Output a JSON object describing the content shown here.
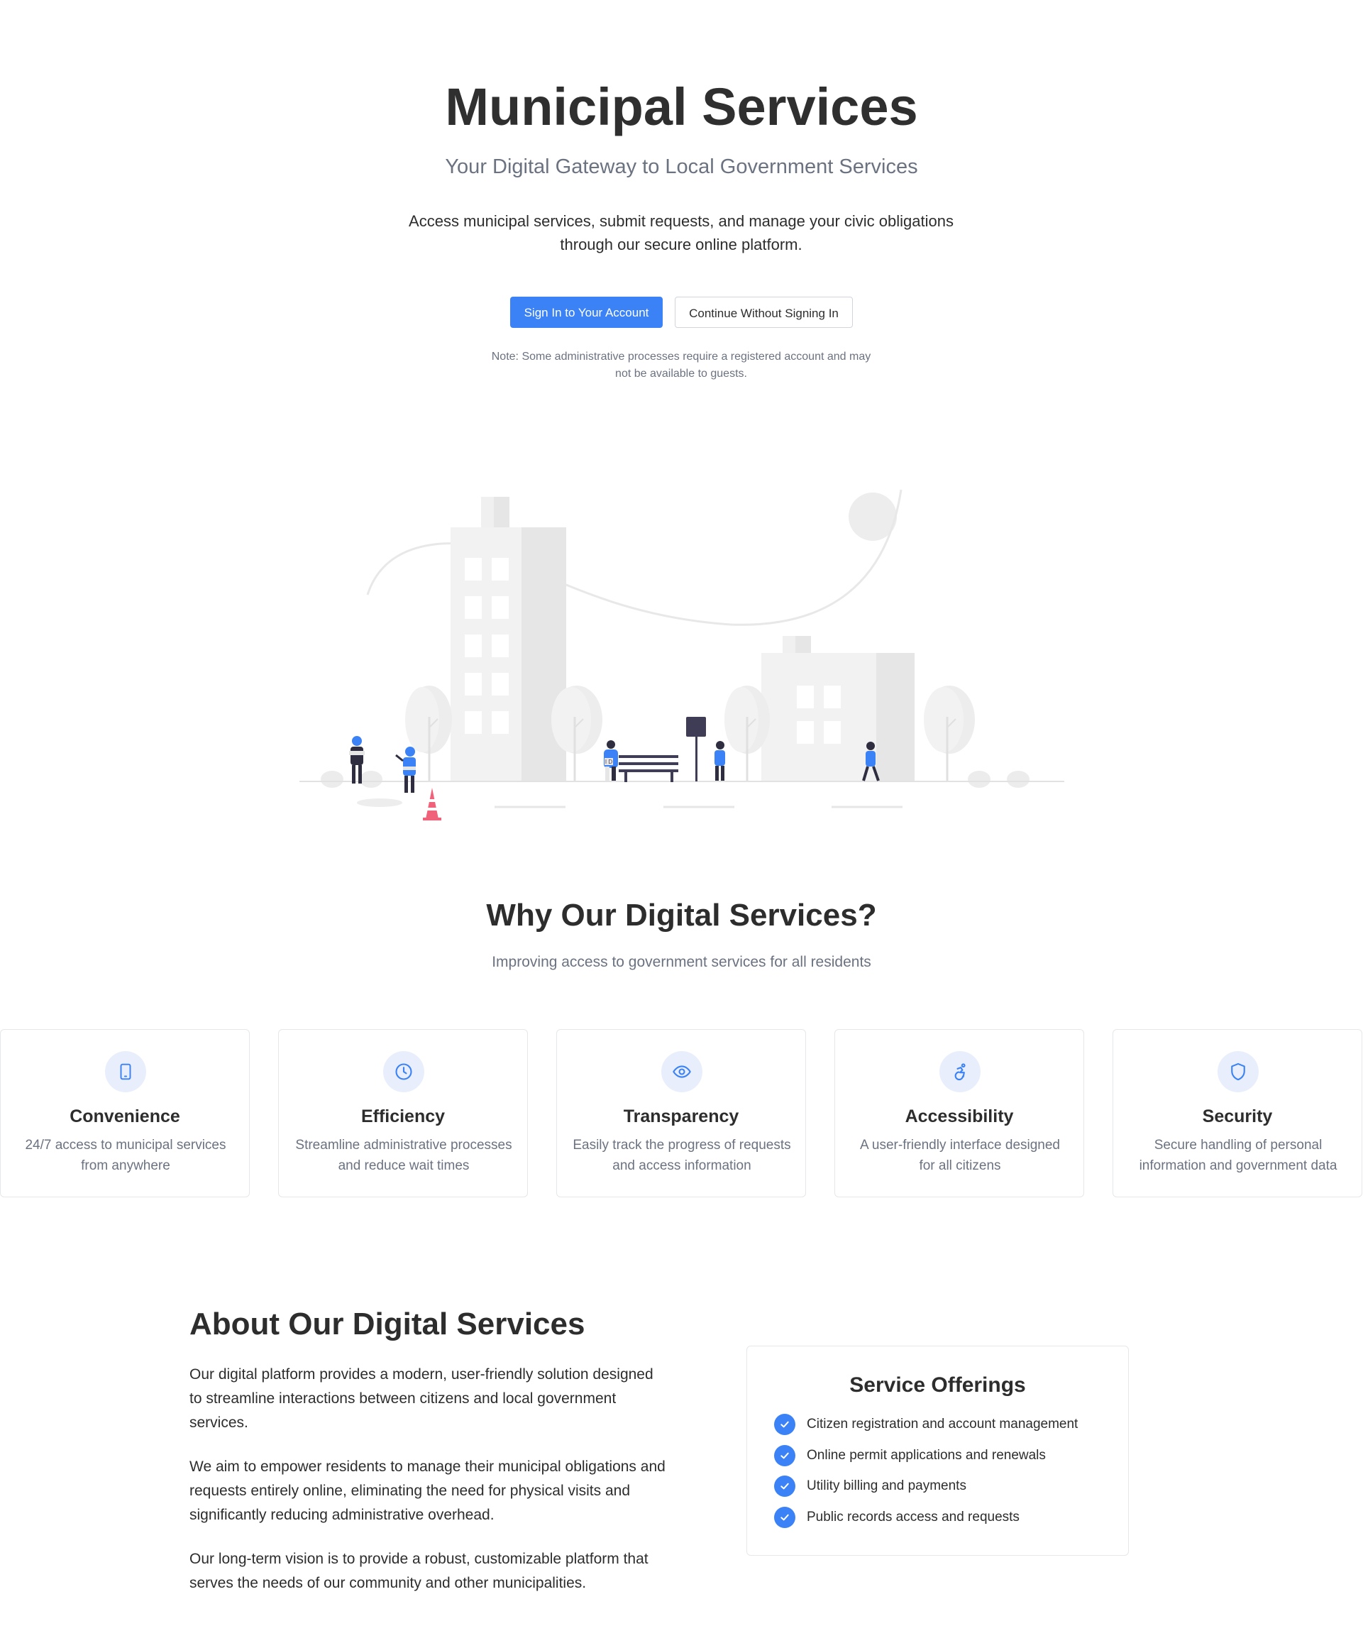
{
  "hero": {
    "title": "Municipal Services",
    "subtitle": "Your Digital Gateway to Local Government Services",
    "lead": "Access municipal services, submit requests, and manage your civic obligations through our secure online platform.",
    "primary_button": "Sign In to Your Account",
    "secondary_button": "Continue Without Signing In",
    "note": "Note: Some administrative processes require a registered account and may not be available to guests.",
    "sign_label": "I D"
  },
  "colors": {
    "accent": "#3b82f6",
    "muted_text": "#6b7280",
    "icon_bg": "#e8eefc",
    "cone": "#f0627a"
  },
  "why": {
    "title": "Why Our Digital Services?",
    "subtitle": "Improving access to government services for all residents",
    "features": [
      {
        "icon": "mobile-icon",
        "title": "Convenience",
        "desc": "24/7 access to municipal services from anywhere"
      },
      {
        "icon": "clock-icon",
        "title": "Efficiency",
        "desc": "Streamline administrative processes and reduce wait times"
      },
      {
        "icon": "eye-icon",
        "title": "Transparency",
        "desc": "Easily track the progress of requests and access information"
      },
      {
        "icon": "accessibility-icon",
        "title": "Accessibility",
        "desc": "A user-friendly interface designed for all citizens"
      },
      {
        "icon": "shield-icon",
        "title": "Security",
        "desc": "Secure handling of personal information and government data"
      }
    ]
  },
  "about": {
    "title": "About Our Digital Services",
    "paragraphs": [
      "Our digital platform provides a modern, user-friendly solution designed to streamline interactions between citizens and local government services.",
      "We aim to empower residents to manage their municipal obligations and requests entirely online, eliminating the need for physical visits and significantly reducing administrative overhead.",
      "Our long-term vision is to provide a robust, customizable platform that serves the needs of our community and other municipalities."
    ],
    "offerings": {
      "title": "Service Offerings",
      "items": [
        "Citizen registration and account management",
        "Online permit applications and renewals",
        "Utility billing and payments",
        "Public records access and requests"
      ]
    }
  }
}
